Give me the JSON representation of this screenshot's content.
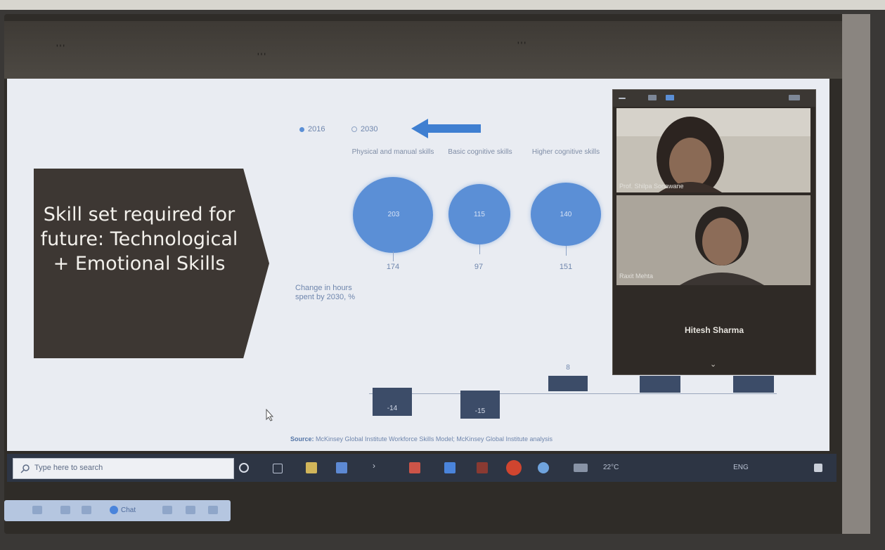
{
  "slide": {
    "title": "Skill set required for future: Technological + Emotional Skills",
    "legend": {
      "current_label": "2016",
      "future_label": "2030"
    },
    "categories": [
      {
        "label": "Physical and manual skills",
        "bubble_value": "203",
        "value_2030": "174",
        "bar_label": "-14"
      },
      {
        "label": "Basic cognitive skills",
        "bubble_value": "115",
        "value_2030": "97",
        "bar_label": "-15"
      },
      {
        "label": "Higher cognitive skills",
        "bubble_value": "140",
        "value_2030": "151",
        "bar_label": "8"
      }
    ],
    "change_caption": "Change in hours spent by 2030, %",
    "source_label": "Source:",
    "source_text": "McKinsey Global Institute Workforce Skills Model; McKinsey Global Institute analysis"
  },
  "video_panel": {
    "participants": [
      {
        "name": "Prof. Shilpa Sonawane"
      },
      {
        "name": "Raxit Mehta"
      }
    ],
    "host_name": "Hitesh Sharma"
  },
  "taskbar": {
    "search_placeholder": "Type here to search",
    "temperature": "22°C",
    "language": "ENG"
  },
  "zoom_bar": {
    "chat_label": "Chat"
  },
  "colors": {
    "accent_blue": "#5b8fd6",
    "slide_bg": "#e9ecf2",
    "title_box": "#3d3733",
    "bar_dark": "#3c4c68"
  }
}
